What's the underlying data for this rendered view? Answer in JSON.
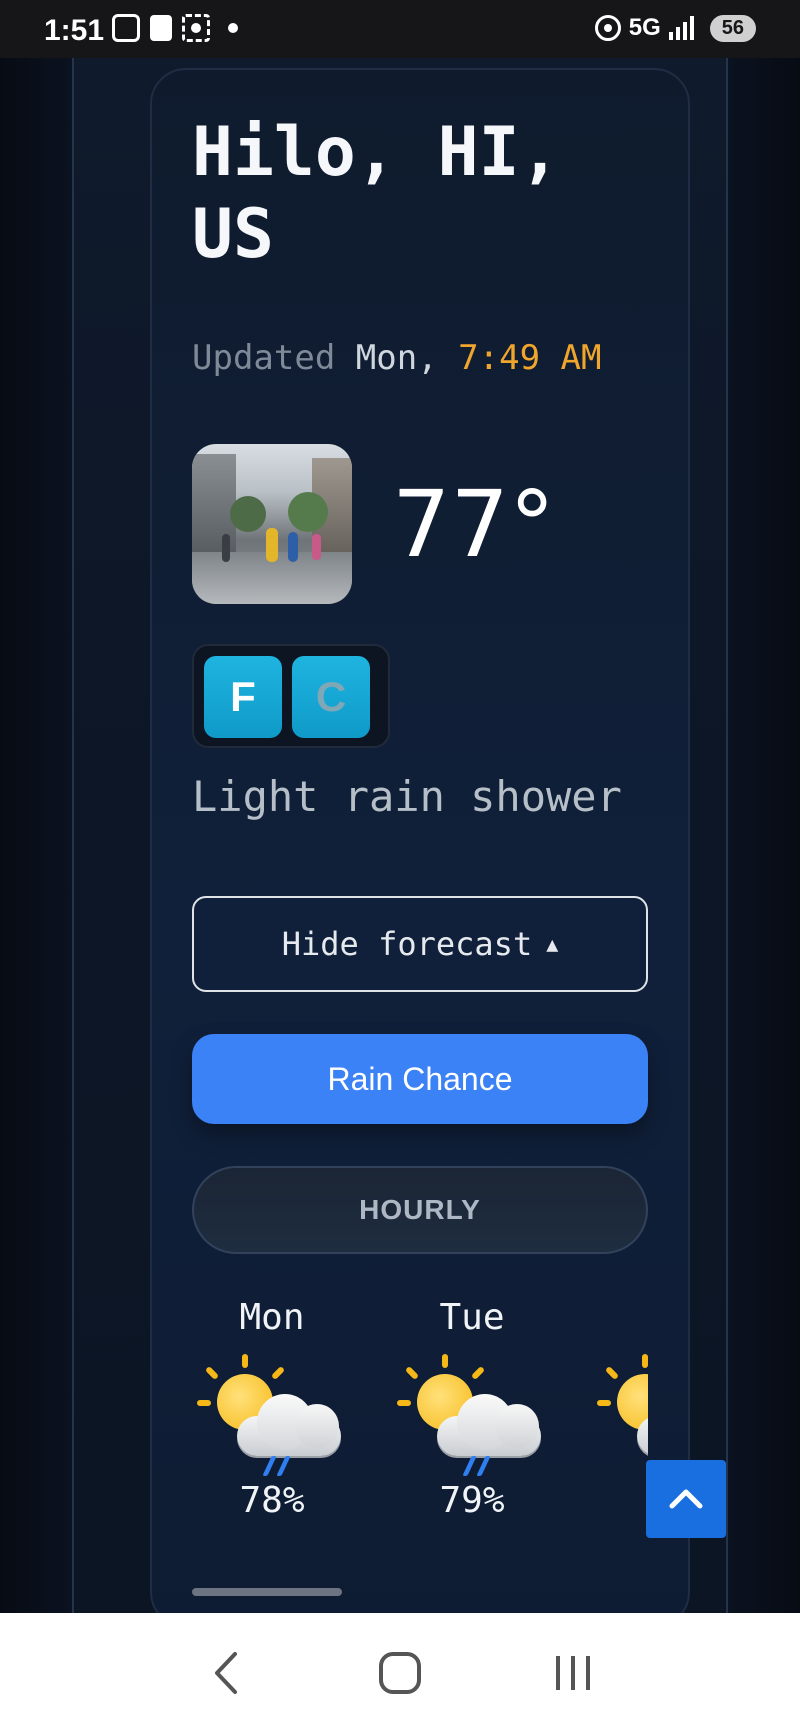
{
  "status_bar": {
    "time": "1:51",
    "network": "5G",
    "battery": "56"
  },
  "location": {
    "city": "Hilo, HI, US"
  },
  "updated": {
    "prefix": "Updated",
    "day": "Mon,",
    "time": "7:49 AM"
  },
  "current": {
    "temperature": "77°",
    "condition": "Light rain shower"
  },
  "unit_toggle": {
    "fahrenheit": "F",
    "celsius": "C",
    "selected": "F"
  },
  "buttons": {
    "hide_forecast": "Hide forecast",
    "hide_forecast_arrow": "▲",
    "rain_chance": "Rain Chance",
    "hourly": "HOURLY"
  },
  "forecast": [
    {
      "day": "Mon",
      "rain_chance": "78%",
      "icon": "sun-cloud-rain-icon"
    },
    {
      "day": "Tue",
      "rain_chance": "79%",
      "icon": "sun-cloud-rain-icon"
    },
    {
      "day": "",
      "rain_chance": "",
      "icon": "sun-cloud-rain-icon"
    }
  ],
  "colors": {
    "accent_time": "#f0a52d",
    "rain_button": "#3b82f6",
    "toggle": "#1fb4e0",
    "scroll_top_button": "#1a6fe0"
  }
}
